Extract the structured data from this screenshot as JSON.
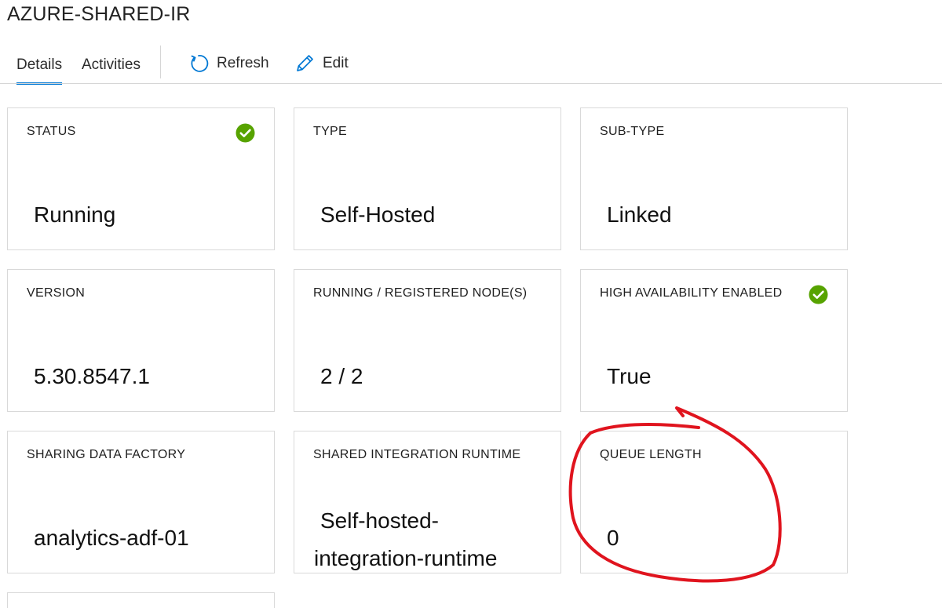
{
  "page": {
    "title": "AZURE-SHARED-IR"
  },
  "tabs": [
    {
      "label": "Details",
      "active": true
    },
    {
      "label": "Activities",
      "active": false
    }
  ],
  "toolbar": {
    "refresh_label": "Refresh",
    "edit_label": "Edit"
  },
  "cards": {
    "status": {
      "label": "STATUS",
      "value": "Running",
      "icon": "check-circle-icon"
    },
    "type": {
      "label": "TYPE",
      "value": "Self-Hosted"
    },
    "subtype": {
      "label": "SUB-TYPE",
      "value": "Linked"
    },
    "version": {
      "label": "VERSION",
      "value": "5.30.8547.1"
    },
    "nodes": {
      "label": "RUNNING / REGISTERED NODE(S)",
      "value": "2 / 2"
    },
    "ha": {
      "label": "HIGH AVAILABILITY ENABLED",
      "value": "True",
      "icon": "check-circle-icon"
    },
    "sharing_factory": {
      "label": "SHARING DATA FACTORY",
      "value": "analytics-adf-01"
    },
    "shared_ir": {
      "label": "SHARED INTEGRATION RUNTIME",
      "value_line1": "Self-hosted-",
      "value_line2": "integration-runtime"
    },
    "queue": {
      "label": "QUEUE LENGTH",
      "value": "0"
    }
  },
  "colors": {
    "accent": "#0078d4",
    "success": "#57a300",
    "annotation": "#e0141e"
  }
}
